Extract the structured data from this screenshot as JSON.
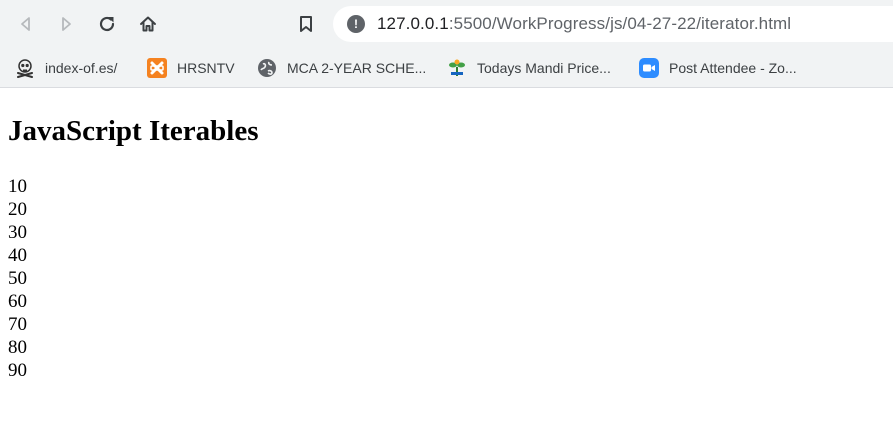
{
  "browser": {
    "url_host": "127.0.0.1",
    "url_rest": ":5500/WorkProgress/js/04-27-22/iterator.html",
    "icons": {
      "back": "back-arrow-icon",
      "forward": "forward-arrow-icon",
      "reload": "reload-icon",
      "home": "home-icon",
      "bookmark": "bookmark-icon",
      "site_info": "info-icon"
    },
    "site_info_glyph": "!"
  },
  "bookmarks": [
    {
      "label": "index-of.es/",
      "icon": "skull-crossbones-icon"
    },
    {
      "label": "HRSNTV",
      "icon": "xampp-logo-icon"
    },
    {
      "label": "MCA 2-YEAR SCHE...",
      "icon": "globe-icon"
    },
    {
      "label": "Todays Mandi Price...",
      "icon": "plant-logo-icon"
    },
    {
      "label": "Post Attendee - Zo...",
      "icon": "zoom-video-icon"
    }
  ],
  "page": {
    "heading": "JavaScript Iterables",
    "values": [
      "10",
      "20",
      "30",
      "40",
      "50",
      "60",
      "70",
      "80",
      "90"
    ]
  },
  "colors": {
    "toolbar_bg": "#f1f3f4",
    "icon_gray": "#5f6368",
    "xampp_orange": "#f58220",
    "zoom_blue": "#2d8cff"
  }
}
